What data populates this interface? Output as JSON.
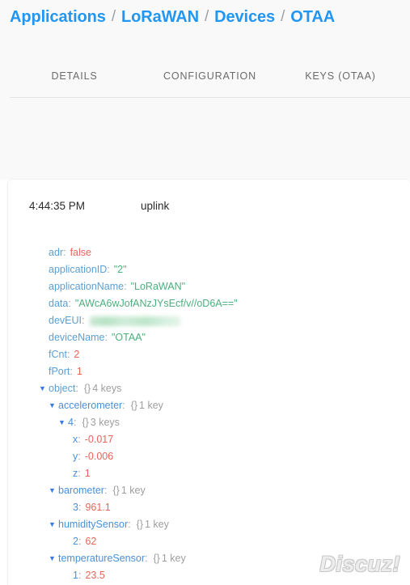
{
  "breadcrumb": {
    "separator": "/",
    "items": [
      {
        "label": "Applications"
      },
      {
        "label": "LoRaWAN"
      },
      {
        "label": "Devices"
      },
      {
        "label": "OTAA"
      }
    ]
  },
  "tabs": [
    {
      "label": "DETAILS"
    },
    {
      "label": "CONFIGURATION"
    },
    {
      "label": "KEYS (OTAA)"
    }
  ],
  "event": {
    "time": "4:44:35 PM",
    "type": "uplink"
  },
  "json_rows": [
    {
      "key": "adr",
      "colon": ":",
      "value": "false",
      "value_type": "bool"
    },
    {
      "key": "applicationID",
      "colon": ":",
      "value": "\"2\"",
      "value_type": "string"
    },
    {
      "key": "applicationName",
      "colon": ":",
      "value": "\"LoRaWAN\"",
      "value_type": "string"
    },
    {
      "key": "data",
      "colon": ":",
      "value": "\"AWcA6wJofANzJYsEcf/v//oD6A==\"",
      "value_type": "string"
    },
    {
      "key": "devEUI",
      "colon": ":",
      "value": "",
      "value_type": "redacted"
    },
    {
      "key": "deviceName",
      "colon": ":",
      "value": "\"OTAA\"",
      "value_type": "string"
    },
    {
      "key": "fCnt",
      "colon": ":",
      "value": "2",
      "value_type": "number"
    },
    {
      "key": "fPort",
      "colon": ":",
      "value": "1",
      "value_type": "number"
    },
    {
      "key": "object",
      "colon": ":",
      "braces": "{}",
      "meta": "4 keys",
      "arrow": "▼"
    },
    {
      "key": "accelerometer",
      "colon": ":",
      "braces": "{}",
      "meta": "1 key",
      "arrow": "▼"
    },
    {
      "key": "4",
      "colon": ":",
      "braces": "{}",
      "meta": "3 keys",
      "arrow": "▼"
    },
    {
      "key": "x",
      "colon": ":",
      "value": "-0.017",
      "value_type": "number"
    },
    {
      "key": "y",
      "colon": ":",
      "value": "-0.006",
      "value_type": "number"
    },
    {
      "key": "z",
      "colon": ":",
      "value": "1",
      "value_type": "number"
    },
    {
      "key": "barometer",
      "colon": ":",
      "braces": "{}",
      "meta": "1 key",
      "arrow": "▼"
    },
    {
      "key": "3",
      "colon": ":",
      "value": "961.1",
      "value_type": "number"
    },
    {
      "key": "humiditySensor",
      "colon": ":",
      "braces": "{}",
      "meta": "1 key",
      "arrow": "▼"
    },
    {
      "key": "2",
      "colon": ":",
      "value": "62",
      "value_type": "number"
    },
    {
      "key": "temperatureSensor",
      "colon": ":",
      "braces": "{}",
      "meta": "1 key",
      "arrow": "▼"
    },
    {
      "key": "1",
      "colon": ":",
      "value": "23.5",
      "value_type": "number"
    }
  ],
  "watermark": {
    "text": "Discuz!"
  },
  "colors": {
    "link": "#2196f3",
    "key": "#5a9fd4",
    "string_value": "#4caf7d",
    "number_value": "#e8645a",
    "meta": "#9e9e9e",
    "arrow": "#3b78e7",
    "page_top_bg": "#f9f9f9",
    "card_bg": "#ffffff"
  }
}
